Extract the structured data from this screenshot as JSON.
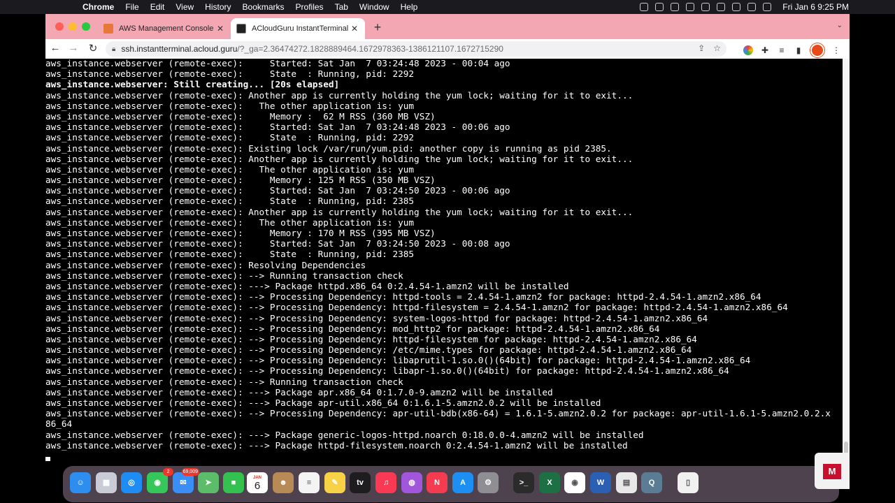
{
  "menubar": {
    "apple_glyph": "",
    "app_name": "Chrome",
    "items": [
      "File",
      "Edit",
      "View",
      "History",
      "Bookmarks",
      "Profiles",
      "Tab",
      "Window",
      "Help"
    ],
    "clock": "Fri Jan 6  9:25 PM"
  },
  "browser": {
    "tabs": [
      {
        "title": "AWS Management Console",
        "active": false
      },
      {
        "title": "ACloudGuru InstantTerminal",
        "active": true
      }
    ],
    "close_glyph": "✕",
    "new_tab_glyph": "+",
    "url_host": "ssh.instantterminal.acloud.guru",
    "url_rest": "/?_ga=2.36474272.1828889464.1672978363-1386121107.1672715290"
  },
  "terminal": {
    "lines": [
      {
        "text": "aws_instance.webserver (remote-exec):     Started: Sat Jan  7 03:24:48 2023 - 00:04 ago",
        "bold": false
      },
      {
        "text": "aws_instance.webserver (remote-exec):     State  : Running, pid: 2292",
        "bold": false
      },
      {
        "text": "aws_instance.webserver: Still creating... [20s elapsed]",
        "bold": true
      },
      {
        "text": "aws_instance.webserver (remote-exec): Another app is currently holding the yum lock; waiting for it to exit...",
        "bold": false
      },
      {
        "text": "aws_instance.webserver (remote-exec):   The other application is: yum",
        "bold": false
      },
      {
        "text": "aws_instance.webserver (remote-exec):     Memory :  62 M RSS (360 MB VSZ)",
        "bold": false
      },
      {
        "text": "aws_instance.webserver (remote-exec):     Started: Sat Jan  7 03:24:48 2023 - 00:06 ago",
        "bold": false
      },
      {
        "text": "aws_instance.webserver (remote-exec):     State  : Running, pid: 2292",
        "bold": false
      },
      {
        "text": "aws_instance.webserver (remote-exec): Existing lock /var/run/yum.pid: another copy is running as pid 2385.",
        "bold": false
      },
      {
        "text": "aws_instance.webserver (remote-exec): Another app is currently holding the yum lock; waiting for it to exit...",
        "bold": false
      },
      {
        "text": "aws_instance.webserver (remote-exec):   The other application is: yum",
        "bold": false
      },
      {
        "text": "aws_instance.webserver (remote-exec):     Memory : 125 M RSS (350 MB VSZ)",
        "bold": false
      },
      {
        "text": "aws_instance.webserver (remote-exec):     Started: Sat Jan  7 03:24:50 2023 - 00:06 ago",
        "bold": false
      },
      {
        "text": "aws_instance.webserver (remote-exec):     State  : Running, pid: 2385",
        "bold": false
      },
      {
        "text": "aws_instance.webserver (remote-exec): Another app is currently holding the yum lock; waiting for it to exit...",
        "bold": false
      },
      {
        "text": "aws_instance.webserver (remote-exec):   The other application is: yum",
        "bold": false
      },
      {
        "text": "aws_instance.webserver (remote-exec):     Memory : 170 M RSS (395 MB VSZ)",
        "bold": false
      },
      {
        "text": "aws_instance.webserver (remote-exec):     Started: Sat Jan  7 03:24:50 2023 - 00:08 ago",
        "bold": false
      },
      {
        "text": "aws_instance.webserver (remote-exec):     State  : Running, pid: 2385",
        "bold": false
      },
      {
        "text": "aws_instance.webserver (remote-exec): Resolving Dependencies",
        "bold": false
      },
      {
        "text": "aws_instance.webserver (remote-exec): --> Running transaction check",
        "bold": false
      },
      {
        "text": "aws_instance.webserver (remote-exec): ---> Package httpd.x86_64 0:2.4.54-1.amzn2 will be installed",
        "bold": false
      },
      {
        "text": "aws_instance.webserver (remote-exec): --> Processing Dependency: httpd-tools = 2.4.54-1.amzn2 for package: httpd-2.4.54-1.amzn2.x86_64",
        "bold": false
      },
      {
        "text": "aws_instance.webserver (remote-exec): --> Processing Dependency: httpd-filesystem = 2.4.54-1.amzn2 for package: httpd-2.4.54-1.amzn2.x86_64",
        "bold": false
      },
      {
        "text": "aws_instance.webserver (remote-exec): --> Processing Dependency: system-logos-httpd for package: httpd-2.4.54-1.amzn2.x86_64",
        "bold": false
      },
      {
        "text": "aws_instance.webserver (remote-exec): --> Processing Dependency: mod_http2 for package: httpd-2.4.54-1.amzn2.x86_64",
        "bold": false
      },
      {
        "text": "aws_instance.webserver (remote-exec): --> Processing Dependency: httpd-filesystem for package: httpd-2.4.54-1.amzn2.x86_64",
        "bold": false
      },
      {
        "text": "aws_instance.webserver (remote-exec): --> Processing Dependency: /etc/mime.types for package: httpd-2.4.54-1.amzn2.x86_64",
        "bold": false
      },
      {
        "text": "aws_instance.webserver (remote-exec): --> Processing Dependency: libaprutil-1.so.0()(64bit) for package: httpd-2.4.54-1.amzn2.x86_64",
        "bold": false
      },
      {
        "text": "aws_instance.webserver (remote-exec): --> Processing Dependency: libapr-1.so.0()(64bit) for package: httpd-2.4.54-1.amzn2.x86_64",
        "bold": false
      },
      {
        "text": "aws_instance.webserver (remote-exec): --> Running transaction check",
        "bold": false
      },
      {
        "text": "aws_instance.webserver (remote-exec): ---> Package apr.x86_64 0:1.7.0-9.amzn2 will be installed",
        "bold": false
      },
      {
        "text": "aws_instance.webserver (remote-exec): ---> Package apr-util.x86_64 0:1.6.1-5.amzn2.0.2 will be installed",
        "bold": false
      },
      {
        "text": "aws_instance.webserver (remote-exec): --> Processing Dependency: apr-util-bdb(x86-64) = 1.6.1-5.amzn2.0.2 for package: apr-util-1.6.1-5.amzn2.0.2.x",
        "bold": false
      },
      {
        "text": "86_64",
        "bold": false
      },
      {
        "text": "aws_instance.webserver (remote-exec): ---> Package generic-logos-httpd.noarch 0:18.0.0-4.amzn2 will be installed",
        "bold": false
      },
      {
        "text": "aws_instance.webserver (remote-exec): ---> Package httpd-filesystem.noarch 0:2.4.54-1.amzn2 will be installed",
        "bold": false
      }
    ]
  },
  "dock": {
    "apps": [
      {
        "name": "finder",
        "color": "#2e8ef0",
        "label": "☺"
      },
      {
        "name": "launchpad",
        "color": "#c9ccd6",
        "label": "▦"
      },
      {
        "name": "safari",
        "color": "#1e8cf2",
        "label": "◎"
      },
      {
        "name": "messages",
        "color": "#36c75a",
        "label": "◉",
        "badge": "2"
      },
      {
        "name": "mail",
        "color": "#3a8ff7",
        "label": "✉",
        "badge": "69,009"
      },
      {
        "name": "maps",
        "color": "#5bbd6a",
        "label": "➤"
      },
      {
        "name": "facetime",
        "color": "#33c14f",
        "label": "■"
      },
      {
        "name": "calendar",
        "month": "JAN",
        "day": "6"
      },
      {
        "name": "contacts",
        "color": "#b88a55",
        "label": "☻"
      },
      {
        "name": "reminders",
        "color": "#f4f4f4",
        "label": "≡"
      },
      {
        "name": "notes",
        "color": "#f7d247",
        "label": "✎"
      },
      {
        "name": "apple-tv",
        "color": "#1d1d1f",
        "label": "tv"
      },
      {
        "name": "music",
        "color": "#fa3a55",
        "label": "♫"
      },
      {
        "name": "podcasts",
        "color": "#a256dc",
        "label": "◍"
      },
      {
        "name": "news",
        "color": "#f43b4f",
        "label": "N"
      },
      {
        "name": "app-store",
        "color": "#1d8ff2",
        "label": "A"
      },
      {
        "name": "system-settings",
        "color": "#8e8e93",
        "label": "⚙"
      },
      {
        "name": "terminal",
        "color": "#2b2b2b",
        "label": ">_"
      },
      {
        "name": "excel",
        "color": "#1d7044",
        "label": "X"
      },
      {
        "name": "chrome",
        "color": "#ffffff",
        "label": "◉"
      },
      {
        "name": "word",
        "color": "#2b5fb3",
        "label": "W"
      },
      {
        "name": "printer",
        "color": "#e8e8e8",
        "label": "▤"
      },
      {
        "name": "quicktime",
        "color": "#5a7d95",
        "label": "Q"
      },
      {
        "name": "document",
        "color": "#f1f1f1",
        "label": "▯"
      }
    ],
    "mcafee_label": "M"
  }
}
